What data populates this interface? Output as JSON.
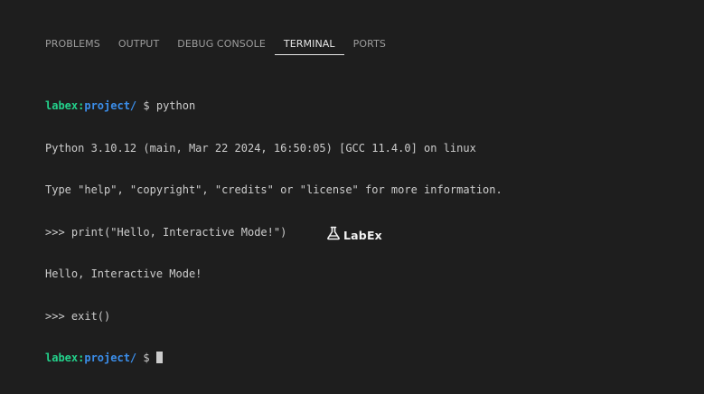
{
  "panel": {
    "tabs": [
      {
        "label": "PROBLEMS"
      },
      {
        "label": "OUTPUT"
      },
      {
        "label": "DEBUG CONSOLE"
      },
      {
        "label": "TERMINAL"
      },
      {
        "label": "PORTS"
      }
    ],
    "active_tab": "TERMINAL"
  },
  "terminal": {
    "prompt_user": "labex",
    "prompt_path": "project/",
    "prompt_symbol": "$",
    "lines": {
      "l1_cmd": "python",
      "l2": "Python 3.10.12 (main, Mar 22 2024, 16:50:05) [GCC 11.4.0] on linux",
      "l3": "Type \"help\", \"copyright\", \"credits\" or \"license\" for more information.",
      "l4": ">>> print(\"Hello, Interactive Mode!\")",
      "l5": "Hello, Interactive Mode!",
      "l6": ">>> exit()"
    }
  },
  "brand": {
    "name": "LabEx",
    "icon": "flask-icon"
  },
  "colors": {
    "background": "#1e1e1e",
    "prompt_user": "#23d18b",
    "prompt_path": "#3b8eea",
    "text": "#cccccc"
  }
}
